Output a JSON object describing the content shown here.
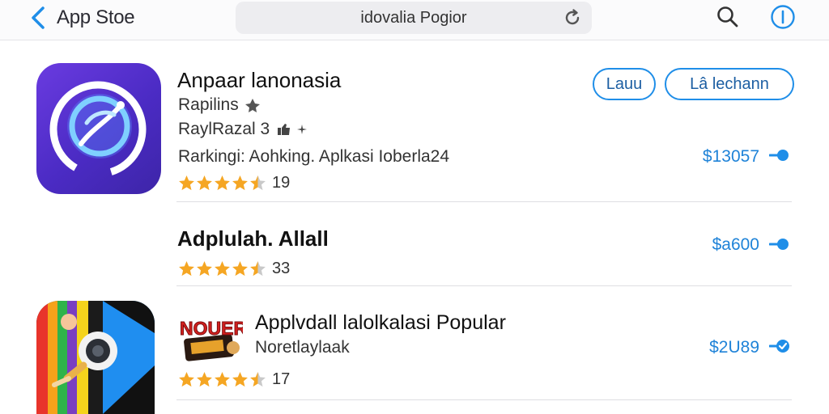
{
  "topbar": {
    "back_label": "App Stoe",
    "search_text": "idovalia Pogior"
  },
  "icons": {
    "back": "chevron-left-icon",
    "reload": "reload-icon",
    "search": "magnifier-icon",
    "info": "info-icon"
  },
  "colors": {
    "accent": "#1f8ee8",
    "star": "#f5a623",
    "icon_purple": "#5631cf"
  },
  "apps": [
    {
      "title": "Anpaar lanonasia",
      "line1": "Rapilins",
      "line2": "RaylRazal  3",
      "line3": "Rarkingi: Aohking. Aplkasi Ioberla24",
      "rating_value": 4.5,
      "rating_count": "19",
      "price": "$13057",
      "buttons": [
        "Lauu",
        "Lâ  lechann"
      ]
    },
    {
      "title": "Adplulah. Allall",
      "rating_value": 4.5,
      "rating_count": "33",
      "price": "$a600"
    },
    {
      "title": "Applvdall lalolkalasi Popular",
      "line1": "Noretlaylaak",
      "badge_text": "NOUER",
      "rating_value": 4.5,
      "rating_count": "17",
      "price": "$2U89"
    }
  ]
}
